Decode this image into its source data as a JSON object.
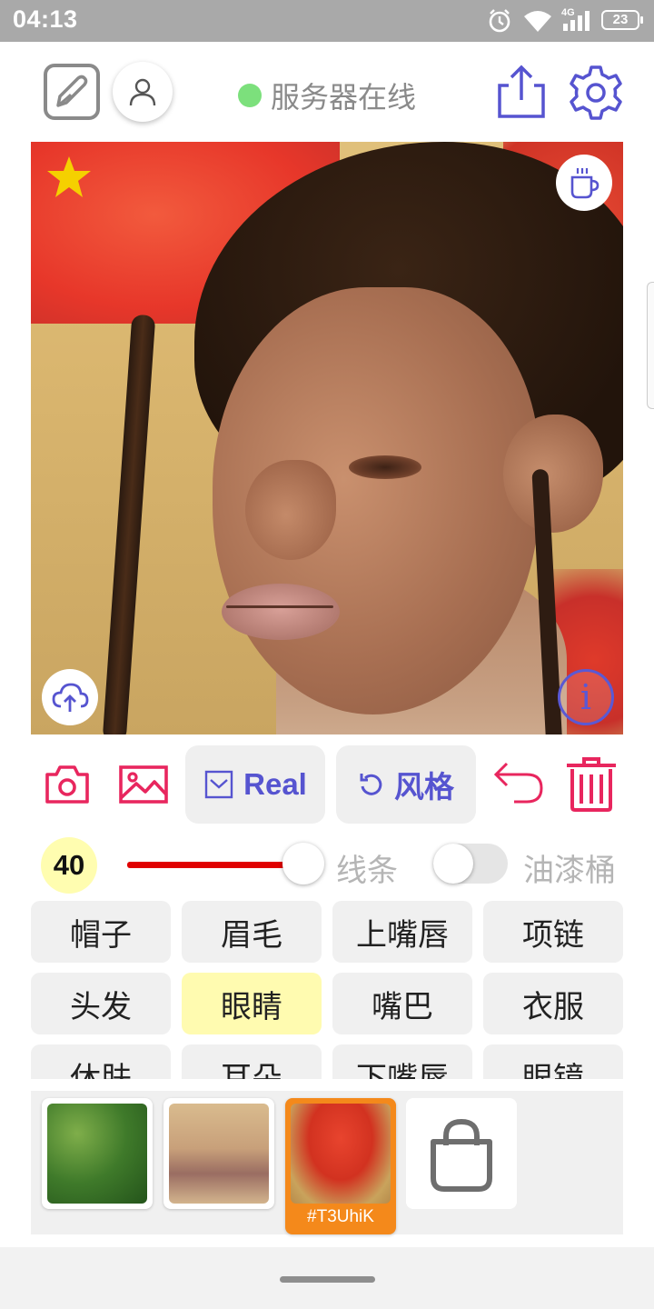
{
  "status_bar": {
    "time": "04:13",
    "network": "4G",
    "battery": "23",
    "icons": [
      "alarm-icon",
      "wifi-icon",
      "signal-icon",
      "battery-icon"
    ]
  },
  "header": {
    "server_status": "服务器在线",
    "status_color": "#7ce07c",
    "icons": [
      "sketch-edit-icon",
      "user-icon",
      "share-icon",
      "settings-icon"
    ]
  },
  "canvas": {
    "icons": [
      "star-icon",
      "coffee-icon",
      "cloud-upload-icon",
      "info-icon"
    ],
    "info_glyph": "i"
  },
  "toolbar": {
    "real_label": "Real",
    "style_label": "风格",
    "icons": [
      "camera-icon",
      "image-icon",
      "checkbox-icon",
      "rotate-icon",
      "undo-icon",
      "trash-icon"
    ],
    "accent": "#5654d0",
    "danger": "#e8265e"
  },
  "brush": {
    "size": "40",
    "slider_value": 0.8,
    "slider_label": "线条",
    "toggle_on": false,
    "toggle_label": "油漆桶"
  },
  "parts": [
    {
      "label": "帽子",
      "selected": false
    },
    {
      "label": "眉毛",
      "selected": false
    },
    {
      "label": "上嘴唇",
      "selected": false
    },
    {
      "label": "项链",
      "selected": false
    },
    {
      "label": "头发",
      "selected": false
    },
    {
      "label": "眼睛",
      "selected": true
    },
    {
      "label": "嘴巴",
      "selected": false
    },
    {
      "label": "衣服",
      "selected": false
    },
    {
      "label": "休肤",
      "selected": false
    },
    {
      "label": "耳朵",
      "selected": false
    },
    {
      "label": "下嘴唇",
      "selected": false
    },
    {
      "label": "眼镜",
      "selected": false
    }
  ],
  "gallery": {
    "active_caption": "#T3UhiK",
    "active_color": "#f4891b",
    "shop_icon": "shopping-bag-icon"
  }
}
